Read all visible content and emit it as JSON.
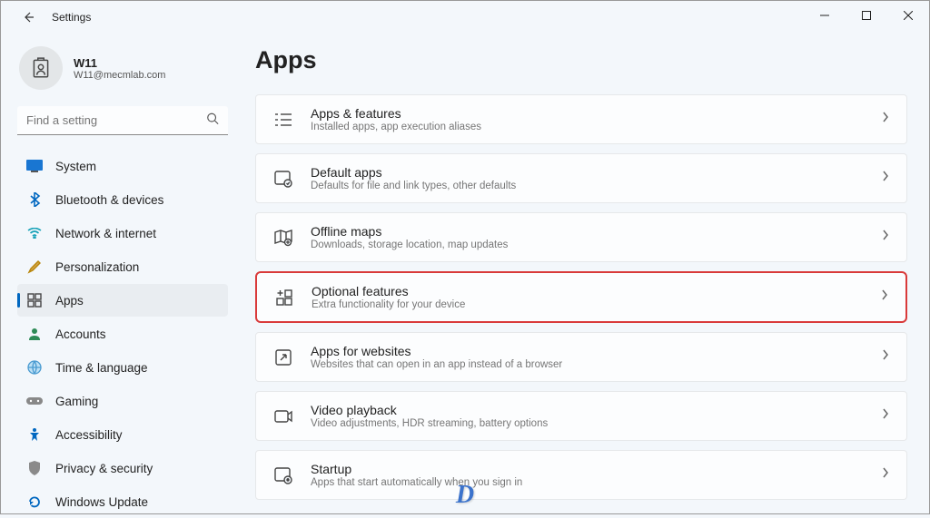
{
  "titlebar": {
    "title": "Settings"
  },
  "user": {
    "name": "W11",
    "email": "W11@mecmlab.com"
  },
  "search": {
    "placeholder": "Find a setting"
  },
  "sidebar": {
    "items": [
      {
        "label": "System"
      },
      {
        "label": "Bluetooth & devices"
      },
      {
        "label": "Network & internet"
      },
      {
        "label": "Personalization"
      },
      {
        "label": "Apps"
      },
      {
        "label": "Accounts"
      },
      {
        "label": "Time & language"
      },
      {
        "label": "Gaming"
      },
      {
        "label": "Accessibility"
      },
      {
        "label": "Privacy & security"
      },
      {
        "label": "Windows Update"
      }
    ]
  },
  "page": {
    "title": "Apps"
  },
  "cards": [
    {
      "title": "Apps & features",
      "sub": "Installed apps, app execution aliases"
    },
    {
      "title": "Default apps",
      "sub": "Defaults for file and link types, other defaults"
    },
    {
      "title": "Offline maps",
      "sub": "Downloads, storage location, map updates"
    },
    {
      "title": "Optional features",
      "sub": "Extra functionality for your device"
    },
    {
      "title": "Apps for websites",
      "sub": "Websites that can open in an app instead of a browser"
    },
    {
      "title": "Video playback",
      "sub": "Video adjustments, HDR streaming, battery options"
    },
    {
      "title": "Startup",
      "sub": "Apps that start automatically when you sign in"
    }
  ],
  "watermark": "D"
}
